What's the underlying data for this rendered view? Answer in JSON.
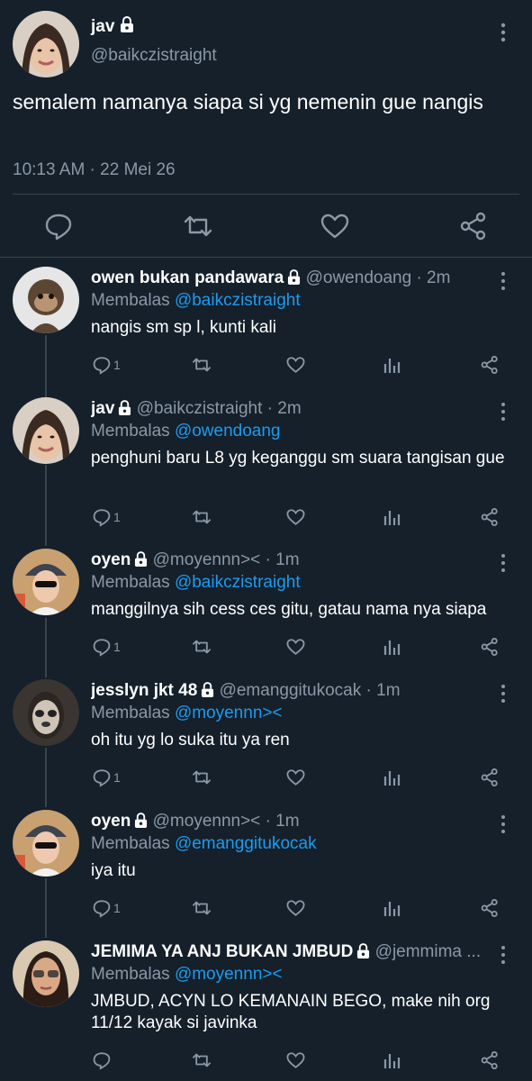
{
  "colors": {
    "background": "#15202b",
    "divider": "#38444d",
    "muted": "#8b98a5",
    "link": "#1d9bf0",
    "text": "#ffffff"
  },
  "main_tweet": {
    "name": "jav",
    "handle": "@baikczistraight",
    "text": "semalem namanya siapa si yg nemenin gue nangis",
    "timestamp": "10:13 AM · 22 Mei 26",
    "icons": [
      "reply-icon",
      "retweet-icon",
      "like-icon",
      "share-icon"
    ]
  },
  "replies": [
    {
      "name": "owen bukan pandawara",
      "handle": "@owendoang",
      "time": "· 2m",
      "replying_prefix": "Membalas",
      "replying_to": "@baikczistraight",
      "text": "nangis sm sp l, kunti kali",
      "reply_count": "1"
    },
    {
      "name": "jav",
      "handle": "@baikczistraight",
      "time": "· 2m",
      "replying_prefix": "Membalas",
      "replying_to": "@owendoang",
      "text": "penghuni baru L8 yg keganggu sm suara tangisan gue",
      "reply_count": "1"
    },
    {
      "name": "oyen",
      "handle": "@moyennn><",
      "time": "· 1m",
      "replying_prefix": "Membalas",
      "replying_to": "@baikczistraight",
      "text": "manggilnya sih cess ces gitu, gatau nama nya siapa",
      "reply_count": "1"
    },
    {
      "name": "jesslyn jkt 48",
      "handle": "@emanggitukocak",
      "time": "· 1m",
      "replying_prefix": "Membalas",
      "replying_to": "@moyennn><",
      "text": "oh itu yg lo suka itu ya ren",
      "reply_count": "1"
    },
    {
      "name": "oyen",
      "handle": "@moyennn><",
      "time": "· 1m",
      "replying_prefix": "Membalas",
      "replying_to": "@emanggitukocak",
      "text": "iya itu",
      "reply_count": "1"
    },
    {
      "name": "JEMIMA YA ANJ BUKAN JMBUD",
      "handle": "@jemmima ...",
      "time": "",
      "replying_prefix": "Membalas",
      "replying_to": "@moyennn><",
      "text": "JMBUD, ACYN LO KEMANAIN BEGO, make nih org 11/12 kayak si javinka",
      "reply_count": ""
    }
  ]
}
